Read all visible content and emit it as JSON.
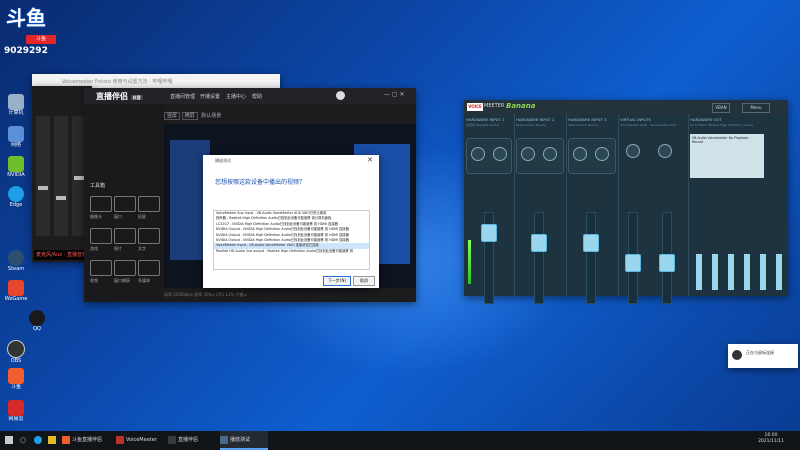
{
  "overlay": {
    "logo_text": "斗鱼",
    "room_number": "9029292",
    "badge": "斗鱼"
  },
  "desktop": {
    "icons": [
      {
        "label": "计算机",
        "color": "#9ab0c8"
      },
      {
        "label": "网络",
        "color": "#5b8fd8"
      },
      {
        "label": "NVIDIA",
        "color": "#6fbf2c"
      },
      {
        "label": "Edge",
        "color": "#1f9fe6"
      },
      {
        "label": "Steam",
        "color": "#2b4f6f"
      },
      {
        "label": "WeGame",
        "color": "#e6462b"
      },
      {
        "label": "QQ",
        "color": "#1a1a1a"
      },
      {
        "label": "OBS",
        "color": "#333"
      },
      {
        "label": "斗鱼",
        "color": "#f25e2c"
      },
      {
        "label": "网易云",
        "color": "#d62a2a"
      }
    ]
  },
  "white_window": {
    "title": "Voicemeeter Potato 使用与设置方法 - 哔哩哔哩"
  },
  "mixer": {
    "tag": "麦克风/Aux  ·  直播音频"
  },
  "stream_app": {
    "brand": "直播伴侣",
    "brand_badge": "抖音",
    "nav": [
      "直播间管理",
      "开播设置",
      "主播中心",
      "帮助"
    ],
    "preview_tabs": [
      "竖屏",
      "横屏",
      "默认场景"
    ],
    "side_items": [
      "摄像头",
      "窗口",
      "投屏",
      "游戏",
      "图片",
      "文字",
      "视频",
      "窗口捕获",
      "多媒体"
    ],
    "side_header": "工具箱",
    "footer": "码率 2500kbps  帧率 30fps  CPU 12%  开播 ▸"
  },
  "dialog": {
    "caption": "播放测试",
    "question": "您想按哪这款设备中播出的视频？",
    "options": [
      "VoiceMeeter Aux Input - VB-Audio VoiceMeeter AUX VAIO已停止使用",
      "扬声器 - Realtek High Definition Audio已找到此设备可能被移 到计算机面板",
      "LC32G7 - NVIDIA High Definition Audio已找到此设备可能被移 到 HDMI 连接器",
      "NVIDIA Output - NVIDIA High Definition Audio已找到此设备可能被移 到 HDMI 连接器",
      "NVIDIA Output - NVIDIA High Definition Audio已找到此设备可能被移 到 HDMI 连接器",
      "NVIDIA Output - NVIDIA High Definition Audio已找到此设备可能被移 到 HDMI 连接器",
      "VoiceMeeter Input - VB-Audio VoiceMeeter VAIO 连接状态已连接",
      "Realtek HD Audio 2nd output - Realtek High Definition Audio已找到此设备可能被移 到"
    ],
    "selected_index": 6,
    "next_label": "下一步(N)",
    "cancel_label": "取消"
  },
  "voicemeeter": {
    "name_badge": "VOICE",
    "name": "MEETER",
    "brand": "Banana",
    "vban": "VBAN",
    "menu": "Menu",
    "strips": [
      {
        "title": "HARDWARE INPUT 1",
        "sub": "麦克风 (Realtek Audio)"
      },
      {
        "title": "HARDWARE INPUT 2",
        "sub": "Select Audio Device"
      },
      {
        "title": "HARDWARE INPUT 3",
        "sub": "Select Audio Device"
      },
      {
        "title": "VIRTUAL INPUTS",
        "sub": "Voicemeeter VAIO  ·  Voicemeeter AUX"
      },
      {
        "title": "HARDWARE OUT",
        "sub": "A1 LC32G7 (NVIDIA High Definition Audio)"
      }
    ],
    "lcd_text": "VB-Audio Voicemeeter\nNo Playback  ·  Record"
  },
  "tray_popup": {
    "text": "正在与鼠标连接"
  },
  "taskbar": {
    "items": [
      {
        "label": "斗鱼直播伴侣",
        "color": "#f25e2c",
        "active": false
      },
      {
        "label": "VoiceMeeter",
        "color": "#c03030",
        "active": false
      },
      {
        "label": "直播伴侣",
        "color": "#3a3a3a",
        "active": false
      },
      {
        "label": "播放测试",
        "color": "#4a6b8a",
        "active": true
      }
    ],
    "time": "16:00",
    "date": "2021/11/11"
  }
}
